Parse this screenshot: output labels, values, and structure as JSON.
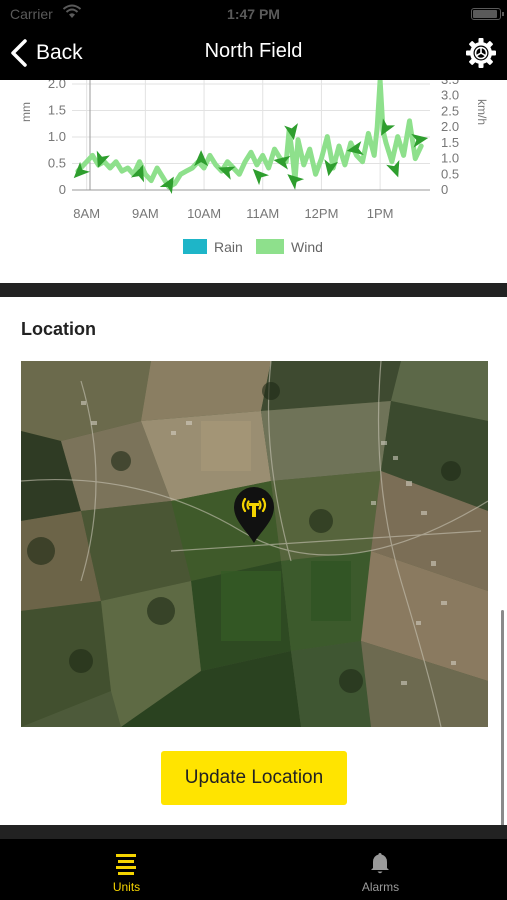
{
  "status_bar": {
    "carrier": "Carrier",
    "time": "1:47 PM"
  },
  "nav": {
    "back_label": "Back",
    "title": "North Field",
    "settings_icon": "gear-icon"
  },
  "chart": {
    "legend": [
      "Rain",
      "Wind"
    ],
    "colors": {
      "rain": "#1eb5c8",
      "wind": "#8ee08c",
      "arrow": "#2e9e2e"
    }
  },
  "chart_data": {
    "type": "line",
    "left_axis_label": "mm",
    "right_axis_label": "km/h",
    "left_ticks": [
      "0",
      "0.5",
      "1.0",
      "1.5",
      "2.0"
    ],
    "right_ticks": [
      "0",
      "0.5",
      "1.0",
      "1.5",
      "2.0",
      "2.5",
      "3.0",
      "3.5"
    ],
    "x_ticks": [
      "8AM",
      "9AM",
      "10AM",
      "11AM",
      "12PM",
      "1PM"
    ],
    "ylim_left": [
      0,
      2.0
    ],
    "ylim_right": [
      0,
      3.5
    ],
    "series": [
      {
        "name": "Rain",
        "axis": "left",
        "values": []
      },
      {
        "name": "Wind",
        "axis": "right",
        "x_hours": [
          7.85,
          8.0,
          8.1,
          8.2,
          8.3,
          8.4,
          8.5,
          8.6,
          8.7,
          8.8,
          8.9,
          9.0,
          9.1,
          9.2,
          9.3,
          9.4,
          9.5,
          9.6,
          9.7,
          9.8,
          9.9,
          10.0,
          10.1,
          10.2,
          10.3,
          10.4,
          10.5,
          10.6,
          10.7,
          10.8,
          10.9,
          11.0,
          11.1,
          11.2,
          11.3,
          11.4,
          11.45,
          11.5,
          11.55,
          11.6,
          11.7,
          11.8,
          11.9,
          12.0,
          12.1,
          12.2,
          12.3,
          12.4,
          12.5,
          12.6,
          12.7,
          12.8,
          12.9,
          12.95,
          13.0,
          13.05,
          13.1,
          13.2,
          13.3,
          13.4,
          13.5,
          13.6,
          13.7
        ],
        "values": [
          0.6,
          0.9,
          1.1,
          0.8,
          0.9,
          0.7,
          0.9,
          0.6,
          0.7,
          0.5,
          0.9,
          0.5,
          0.3,
          0.7,
          0.4,
          0.1,
          0.2,
          0.5,
          0.6,
          0.7,
          0.9,
          0.7,
          1.1,
          0.8,
          0.6,
          0.9,
          0.7,
          0.5,
          0.9,
          1.2,
          0.8,
          1.1,
          0.7,
          1.3,
          1.0,
          0.9,
          1.9,
          1.2,
          0.3,
          1.6,
          0.8,
          1.3,
          0.5,
          1.0,
          1.7,
          0.7,
          1.4,
          0.8,
          1.5,
          1.1,
          0.9,
          1.8,
          1.1,
          2.0,
          3.5,
          1.9,
          1.5,
          0.9,
          1.7,
          1.1,
          2.2,
          1.0,
          1.4
        ]
      }
    ],
    "wind_arrows": [
      {
        "x_hour": 7.9,
        "value": 0.6,
        "dir_deg": 225
      },
      {
        "x_hour": 8.25,
        "value": 1.0,
        "dir_deg": 200
      },
      {
        "x_hour": 8.9,
        "value": 0.5,
        "dir_deg": 20
      },
      {
        "x_hour": 9.4,
        "value": 0.15,
        "dir_deg": 30
      },
      {
        "x_hour": 9.95,
        "value": 0.95,
        "dir_deg": 0
      },
      {
        "x_hour": 10.4,
        "value": 0.6,
        "dir_deg": 290
      },
      {
        "x_hour": 10.95,
        "value": 0.45,
        "dir_deg": 315
      },
      {
        "x_hour": 11.35,
        "value": 0.9,
        "dir_deg": 280
      },
      {
        "x_hour": 11.5,
        "value": 1.9,
        "dir_deg": 170
      },
      {
        "x_hour": 11.55,
        "value": 0.3,
        "dir_deg": 310
      },
      {
        "x_hour": 12.15,
        "value": 0.75,
        "dir_deg": 190
      },
      {
        "x_hour": 12.6,
        "value": 1.3,
        "dir_deg": 260
      },
      {
        "x_hour": 13.1,
        "value": 2.0,
        "dir_deg": 210
      },
      {
        "x_hour": 13.25,
        "value": 0.7,
        "dir_deg": 160
      },
      {
        "x_hour": 13.65,
        "value": 1.6,
        "dir_deg": 80
      }
    ]
  },
  "location": {
    "title": "Location",
    "pin_icon": "sensor-station-pin-icon",
    "update_button_label": "Update Location"
  },
  "tabs": [
    {
      "label": "Units",
      "icon": "list-icon",
      "active": true
    },
    {
      "label": "Alarms",
      "icon": "bell-icon",
      "active": false
    }
  ]
}
